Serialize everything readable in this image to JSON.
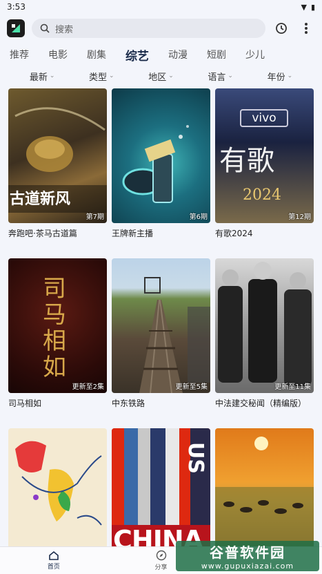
{
  "status": {
    "time": "3:53"
  },
  "search": {
    "placeholder": "搜索"
  },
  "tabs": [
    {
      "label": "推荐"
    },
    {
      "label": "电影"
    },
    {
      "label": "剧集"
    },
    {
      "label": "综艺"
    },
    {
      "label": "动漫"
    },
    {
      "label": "短剧"
    },
    {
      "label": "少儿"
    }
  ],
  "active_tab": "综艺",
  "filters": [
    {
      "label": "最新"
    },
    {
      "label": "类型"
    },
    {
      "label": "地区"
    },
    {
      "label": "语言"
    },
    {
      "label": "年份"
    }
  ],
  "items": [
    {
      "title": "奔跑吧·茶马古道篇",
      "badge": "第7期"
    },
    {
      "title": "王牌新主播",
      "badge": "第6期"
    },
    {
      "title": "有歌2024",
      "badge": "第12期"
    },
    {
      "title": "司马相如",
      "badge": "更新至2集"
    },
    {
      "title": "中东铁路",
      "badge": "更新至5集"
    },
    {
      "title": "中法建交秘闻（精编版）",
      "badge": "更新至11集"
    },
    {
      "title": "",
      "badge": ""
    },
    {
      "title": "",
      "badge": ""
    },
    {
      "title": "",
      "badge": ""
    }
  ],
  "poster_text": {
    "p1": "古道新风",
    "p3_brand": "vivo",
    "p3_main": "有歌",
    "p3_year": "2024",
    "p4": "司马相如",
    "p8_us": "US",
    "p8_china": "CHINA"
  },
  "bottom_nav": [
    {
      "label": "首页"
    },
    {
      "label": "分享"
    }
  ],
  "watermark": {
    "main": "谷普软件园",
    "sub": "www.gupuxiazai.com"
  }
}
